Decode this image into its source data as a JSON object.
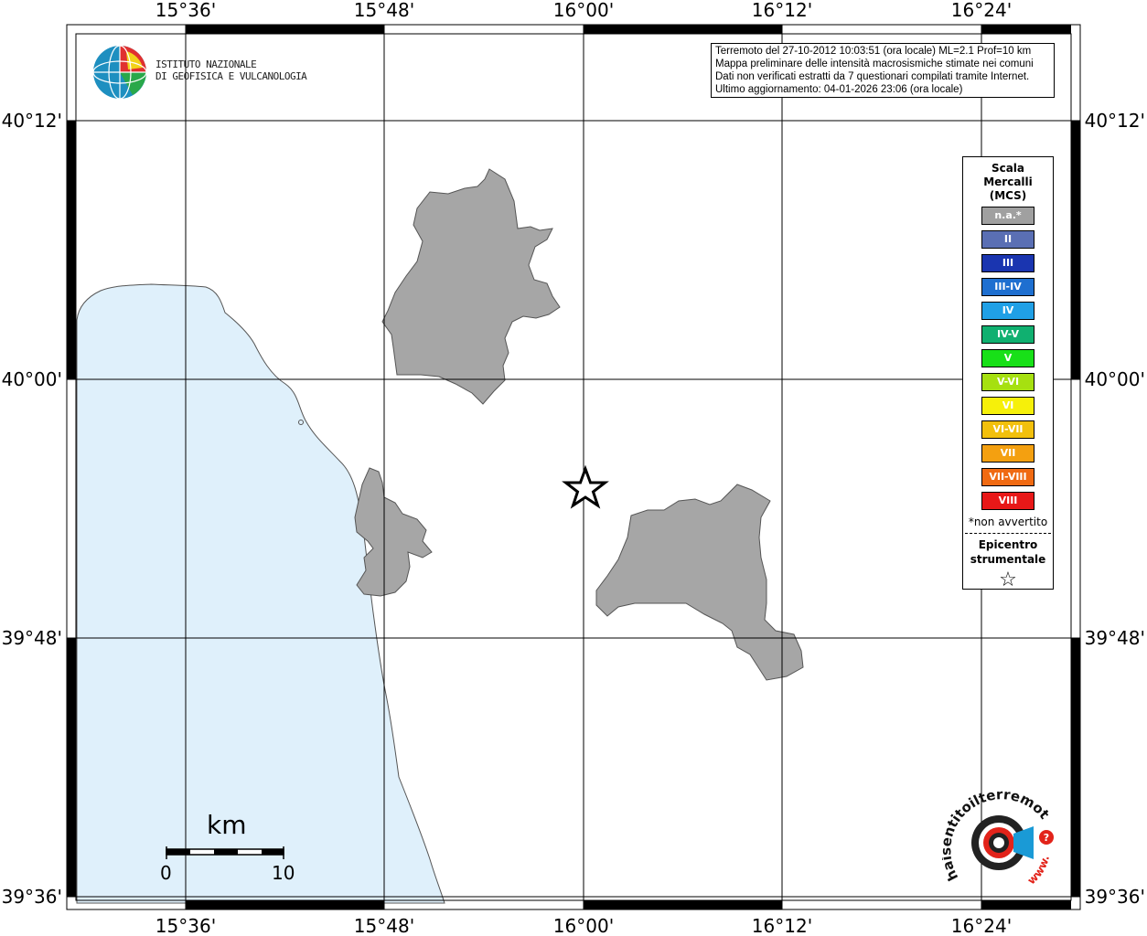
{
  "map": {
    "lon_ticks": [
      "15°36'",
      "15°48'",
      "16°00'",
      "16°12'",
      "16°24'"
    ],
    "lat_ticks": [
      "40°12'",
      "40°00'",
      "39°48'",
      "39°36'"
    ],
    "colors": {
      "sea": "#dff0fb",
      "municipality": "#a6a6a6",
      "grid": "#000000"
    }
  },
  "logo": {
    "line1": "ISTITUTO NAZIONALE",
    "line2": "DI GEOFISICA E VULCANOLOGIA"
  },
  "info": {
    "line1": "Terremoto del 27-10-2012 10:03:51 (ora locale) ML=2.1 Prof=10 km",
    "line2": "Mappa preliminare delle intensità macrosismiche stimate nei comuni",
    "line3": "Dati non verificati estratti da 7 questionari compilati tramite Internet.",
    "line4": "Ultimo aggiornamento: 04-01-2026 23:06 (ora locale)"
  },
  "legend": {
    "title_line1": "Scala",
    "title_line2": "Mercalli",
    "title_line3": "(MCS)",
    "items": [
      {
        "label": "n.a.*",
        "color": "#a0a0a0"
      },
      {
        "label": "II",
        "color": "#5a6fb4"
      },
      {
        "label": "III",
        "color": "#1a35b0"
      },
      {
        "label": "III-IV",
        "color": "#1e6fd0"
      },
      {
        "label": "IV",
        "color": "#20a0e6"
      },
      {
        "label": "IV-V",
        "color": "#10b070"
      },
      {
        "label": "V",
        "color": "#18e018"
      },
      {
        "label": "V-VI",
        "color": "#a6e010"
      },
      {
        "label": "VI",
        "color": "#f6f00a"
      },
      {
        "label": "VI-VII",
        "color": "#f2c00c"
      },
      {
        "label": "VII",
        "color": "#f4a010"
      },
      {
        "label": "VII-VIII",
        "color": "#f06a12"
      },
      {
        "label": "VIII",
        "color": "#e81818"
      }
    ],
    "note": "*non avvertito",
    "epicenter_line1": "Epicentro",
    "epicenter_line2": "strumentale",
    "epicenter_symbol": "☆"
  },
  "scalebar": {
    "unit": "km",
    "min": "0",
    "max": "10"
  },
  "watermark": {
    "text": "haisentitoilterremoto.it",
    "prefix": "www.",
    "icon": "target-icon"
  },
  "epicenter": {
    "icon": "star-icon"
  }
}
